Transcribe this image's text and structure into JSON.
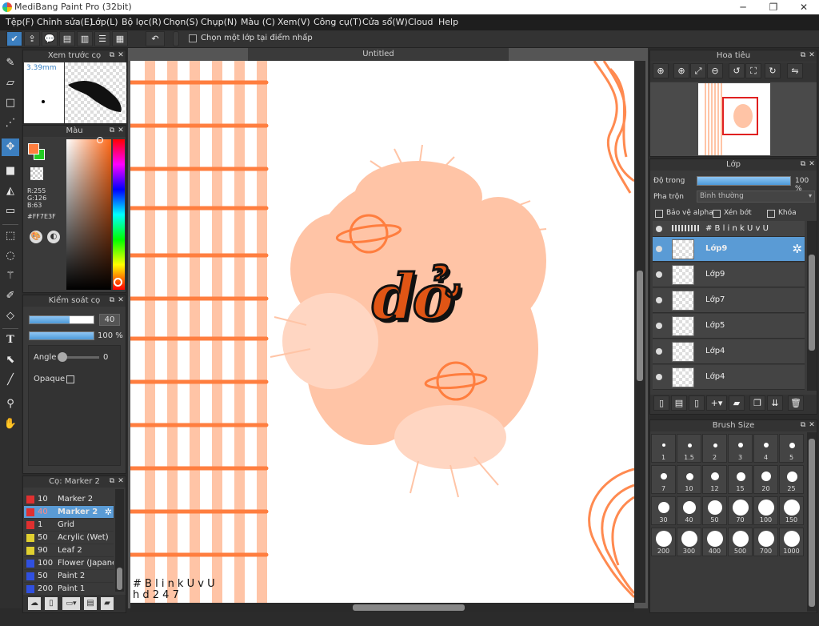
{
  "app": {
    "title": "MediBang Paint Pro (32bit)",
    "window_buttons": [
      "─",
      "❐",
      "✕"
    ]
  },
  "menu": [
    "Tệp(F)",
    "Chỉnh sửa(E)",
    "Lớp(L)",
    "Bộ lọc(R)",
    "Chọn(S)",
    "Chụp(N)",
    "Màu (C)",
    "Xem(V)",
    "Công cụ(T)",
    "Cửa sổ(W)",
    "Cloud",
    "Help"
  ],
  "toolbar": {
    "snap_label": "Chọn một lớp tại điểm nhấp"
  },
  "brush_preview": {
    "title": "Xem trước cọ",
    "size": "3.39mm"
  },
  "color_panel": {
    "title": "Màu",
    "r": "R:255",
    "g": "G:126",
    "b": "B:63",
    "hex": "#FF7E3F",
    "primary": "#FF7E3F",
    "secondary": "#22CC22"
  },
  "brush_control": {
    "title": "Kiểm soát cọ",
    "size_value": "40",
    "size_fraction": 0.62,
    "opacity_value": "100 %",
    "opacity_fraction": 1.0,
    "angle_label": "Angle",
    "angle_value": "0",
    "opaque_label": "Opaque"
  },
  "brush_list": {
    "title": "Cọ: Marker 2",
    "items": [
      {
        "size": "10",
        "name": "Marker 2",
        "color": "#e03030"
      },
      {
        "size": "40",
        "name": "Marker 2",
        "color": "#e03030",
        "selected": true
      },
      {
        "size": "1",
        "name": "Grid",
        "color": "#e03030"
      },
      {
        "size": "50",
        "name": "Acrylic (Wet)",
        "color": "#e0d030"
      },
      {
        "size": "90",
        "name": "Leaf 2",
        "color": "#e0d030"
      },
      {
        "size": "100",
        "name": "Flower (Japanese",
        "color": "#3050e0"
      },
      {
        "size": "50",
        "name": "Paint 2",
        "color": "#3050e0"
      },
      {
        "size": "200",
        "name": "Paint 1",
        "color": "#3050e0"
      }
    ]
  },
  "canvas": {
    "tab": "Untitled",
    "main_text": "dở",
    "watermark_line1": "# B l i n k U v U",
    "watermark_line2": "h d 2 4 7"
  },
  "navigator": {
    "title": "Hoa tiêu"
  },
  "layers": {
    "title": "Lớp",
    "opacity_label": "Độ trong",
    "opacity_value": "100 %",
    "opacity_fraction": 1.0,
    "blend_label": "Pha trộn",
    "blend_value": "Bình thường",
    "protect_alpha": "Bảo vệ alpha",
    "clipping": "Xén bớt",
    "lock": "Khóa",
    "items": [
      {
        "name": "# B l i n k U v U",
        "type": "text"
      },
      {
        "name": "Lớp9",
        "selected": true
      },
      {
        "name": "Lớp9"
      },
      {
        "name": "Lớp7"
      },
      {
        "name": "Lớp5"
      },
      {
        "name": "Lớp4"
      },
      {
        "name": "Lớp4"
      }
    ]
  },
  "brush_size": {
    "title": "Brush Size",
    "sizes": [
      "1",
      "1.5",
      "2",
      "3",
      "4",
      "5",
      "7",
      "10",
      "12",
      "15",
      "20",
      "25",
      "30",
      "40",
      "50",
      "70",
      "100",
      "150",
      "200",
      "300",
      "400",
      "500",
      "700",
      "1000"
    ]
  }
}
